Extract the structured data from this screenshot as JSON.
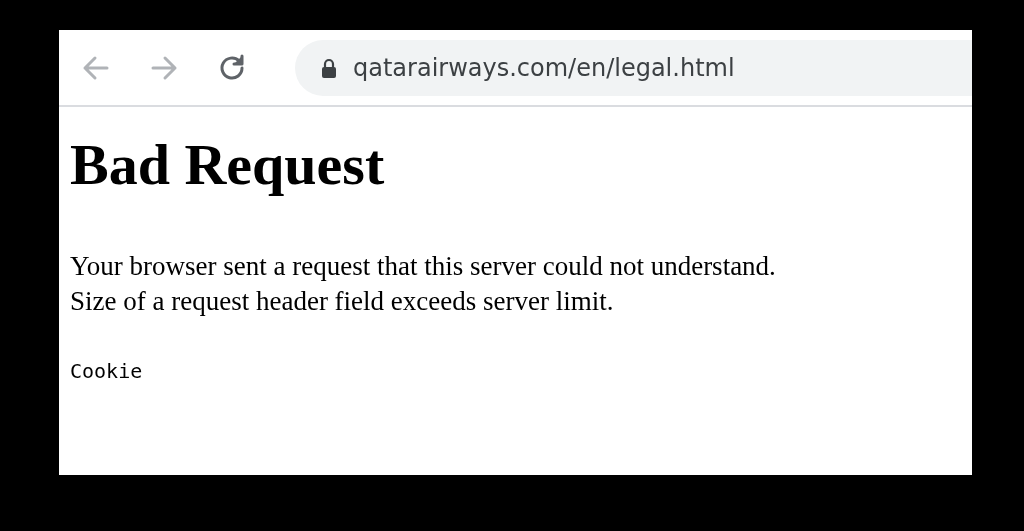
{
  "toolbar": {
    "back": {
      "disabled": true
    },
    "forward": {
      "disabled": true
    },
    "address": "qatarairways.com/en/legal.html"
  },
  "page": {
    "heading": "Bad Request",
    "paragraph": [
      "Your browser sent a request that this server could not understand.",
      "Size of a request header field exceeds server limit."
    ],
    "code": "Cookie"
  }
}
